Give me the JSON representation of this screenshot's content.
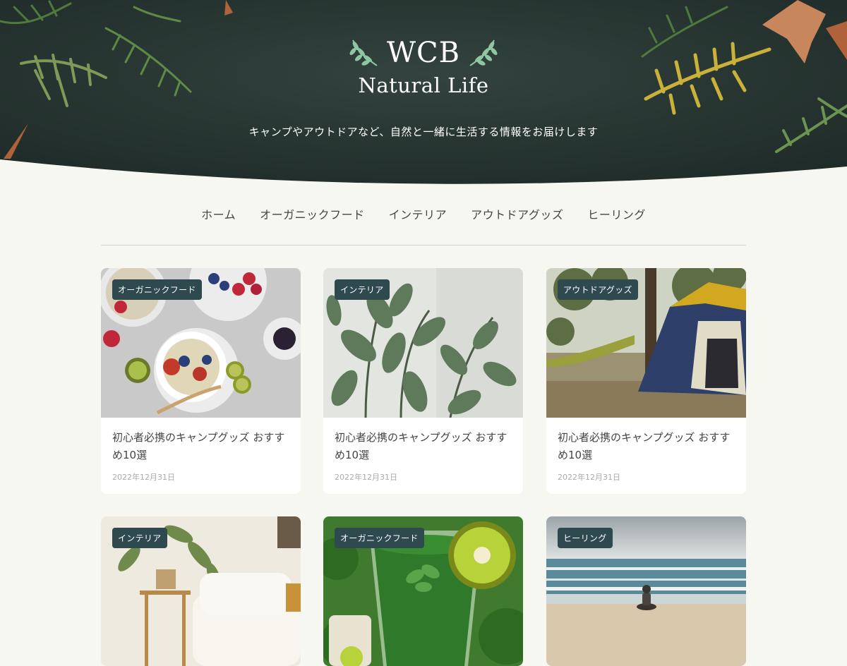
{
  "header": {
    "logo_title": "WCB",
    "logo_subtitle": "Natural Life",
    "tagline": "キャンプやアウトドアなど、自然と一緒に生活する情報をお届けします"
  },
  "nav": {
    "items": [
      "ホーム",
      "オーガニックフード",
      "インテリア",
      "アウトドアグッズ",
      "ヒーリング"
    ]
  },
  "posts": [
    {
      "category": "オーガニックフード",
      "title": "初心者必携のキャンプグッズ おすすめ10選",
      "date": "2022年12月31日"
    },
    {
      "category": "インテリア",
      "title": "初心者必携のキャンプグッズ おすすめ10選",
      "date": "2022年12月31日"
    },
    {
      "category": "アウトドアグッズ",
      "title": "初心者必携のキャンプグッズ おすすめ10選",
      "date": "2022年12月31日"
    },
    {
      "category": "インテリア"
    },
    {
      "category": "オーガニックフード"
    },
    {
      "category": "ヒーリング"
    }
  ],
  "colors": {
    "page_bg": "#f7f7f2",
    "hero_bg": "#2b3a36",
    "tag_bg": "#2f4a4f",
    "laurel": "#8fc7a3"
  }
}
